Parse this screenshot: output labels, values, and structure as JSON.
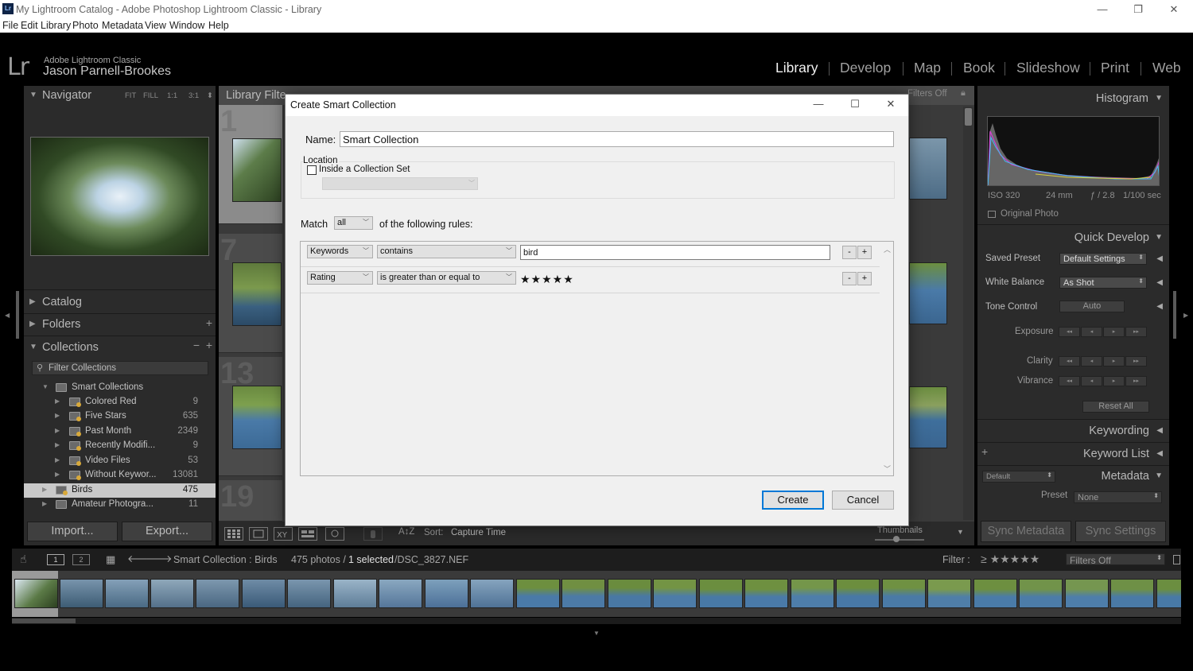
{
  "window": {
    "title": "My Lightroom Catalog - Adobe Photoshop Lightroom Classic - Library",
    "logo": "Lr",
    "minimize": "—",
    "restore": "❐",
    "close": "✕"
  },
  "menu": [
    "File",
    "Edit",
    "Library",
    "Photo",
    "Metadata",
    "View",
    "Window",
    "Help"
  ],
  "identity": {
    "logo": "Lr",
    "app": "Adobe Lightroom Classic",
    "user": "Jason Parnell-Brookes"
  },
  "modules": [
    "Library",
    "Develop",
    "Map",
    "Book",
    "Slideshow",
    "Print",
    "Web"
  ],
  "left_panel": {
    "navigator": {
      "label": "Navigator",
      "zoom": [
        "FIT",
        "FILL",
        "1:1",
        "3:1"
      ]
    },
    "catalog": "Catalog",
    "folders": "Folders",
    "collections": "Collections",
    "filter_placeholder": "Filter Collections",
    "smart_collections": "Smart Collections",
    "items": [
      {
        "name": "Colored Red",
        "count": "9"
      },
      {
        "name": "Five Stars",
        "count": "635"
      },
      {
        "name": "Past Month",
        "count": "2349"
      },
      {
        "name": "Recently Modifi...",
        "count": "9"
      },
      {
        "name": "Video Files",
        "count": "53"
      },
      {
        "name": "Without Keywor...",
        "count": "13081"
      }
    ],
    "birds": {
      "name": "Birds",
      "count": "475"
    },
    "amateur": {
      "name": "Amateur Photogra...",
      "count": "11"
    },
    "import": "Import...",
    "export": "Export..."
  },
  "grid": {
    "filter_label": "Library Filte",
    "filters_off": "Filters Off",
    "cell_numbers": [
      "1",
      "7",
      "13",
      "19"
    ]
  },
  "toolbar": {
    "sort_label": "Sort:",
    "sort_value": "Capture Time",
    "thumbnails": "Thumbnails"
  },
  "right_panel": {
    "histogram": "Histogram",
    "exif": {
      "iso": "ISO 320",
      "focal": "24 mm",
      "aperture": "ƒ / 2.8",
      "shutter": "1/100 sec"
    },
    "original_photo": "Original Photo",
    "quick_develop": "Quick Develop",
    "saved_preset_label": "Saved Preset",
    "saved_preset_value": "Default Settings",
    "white_balance_label": "White Balance",
    "white_balance_value": "As Shot",
    "tone_control_label": "Tone Control",
    "auto": "Auto",
    "exposure": "Exposure",
    "clarity": "Clarity",
    "vibrance": "Vibrance",
    "reset_all": "Reset All",
    "keywording": "Keywording",
    "keyword_list": "Keyword List",
    "metadata": "Metadata",
    "metadata_preset_select": "Default",
    "preset_label": "Preset",
    "preset_value": "None",
    "sync_metadata": "Sync Metadata",
    "sync_settings": "Sync Settings"
  },
  "filmstrip": {
    "source": "Smart Collection : Birds",
    "count": "475 photos /",
    "selected": "1 selected",
    "file": "/DSC_3827.NEF",
    "filter_label": "Filter :",
    "filter_stars": "≥ ★★★★★",
    "filters_off": "Filters Off"
  },
  "dialog": {
    "title": "Create Smart Collection",
    "name_label": "Name:",
    "name_value": "Smart Collection",
    "location_label": "Location",
    "inside_set_label": "Inside a Collection Set",
    "match_label": "Match",
    "match_value": "all",
    "match_rest": "of the following rules:",
    "rules": [
      {
        "field": "Keywords",
        "op": "contains",
        "value": "bird"
      },
      {
        "field": "Rating",
        "op": "is greater than or equal to",
        "stars": "★★★★★"
      }
    ],
    "minus": "-",
    "plus": "+",
    "create": "Create",
    "cancel": "Cancel"
  },
  "colors": {
    "accent": "#0078d7",
    "panel": "#2b2b2b",
    "grid": "#3a3a3a"
  }
}
